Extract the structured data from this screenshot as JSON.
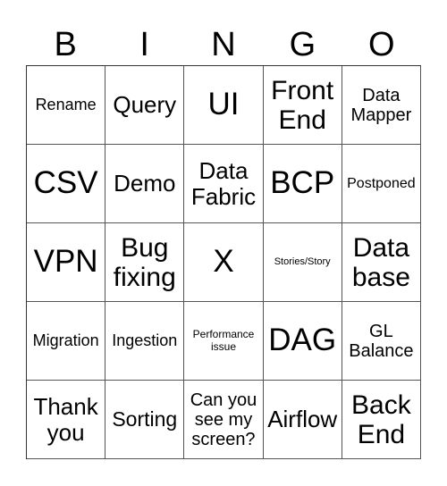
{
  "header": {
    "letters": [
      "B",
      "I",
      "N",
      "G",
      "O"
    ]
  },
  "cells": [
    [
      "Rename",
      "Query",
      "UI",
      "Front End",
      "Data Mapper"
    ],
    [
      "CSV",
      "Demo",
      "Data Fabric",
      "BCP",
      "Postponed"
    ],
    [
      "VPN",
      "Bug fixing",
      "X",
      "Stories/Story",
      "Data base"
    ],
    [
      "Migration",
      "Ingestion",
      "Performance issue",
      "DAG",
      "GL Balance"
    ],
    [
      "Thank you",
      "Sorting",
      "Can you see my screen?",
      "Airflow",
      "Back End"
    ]
  ]
}
